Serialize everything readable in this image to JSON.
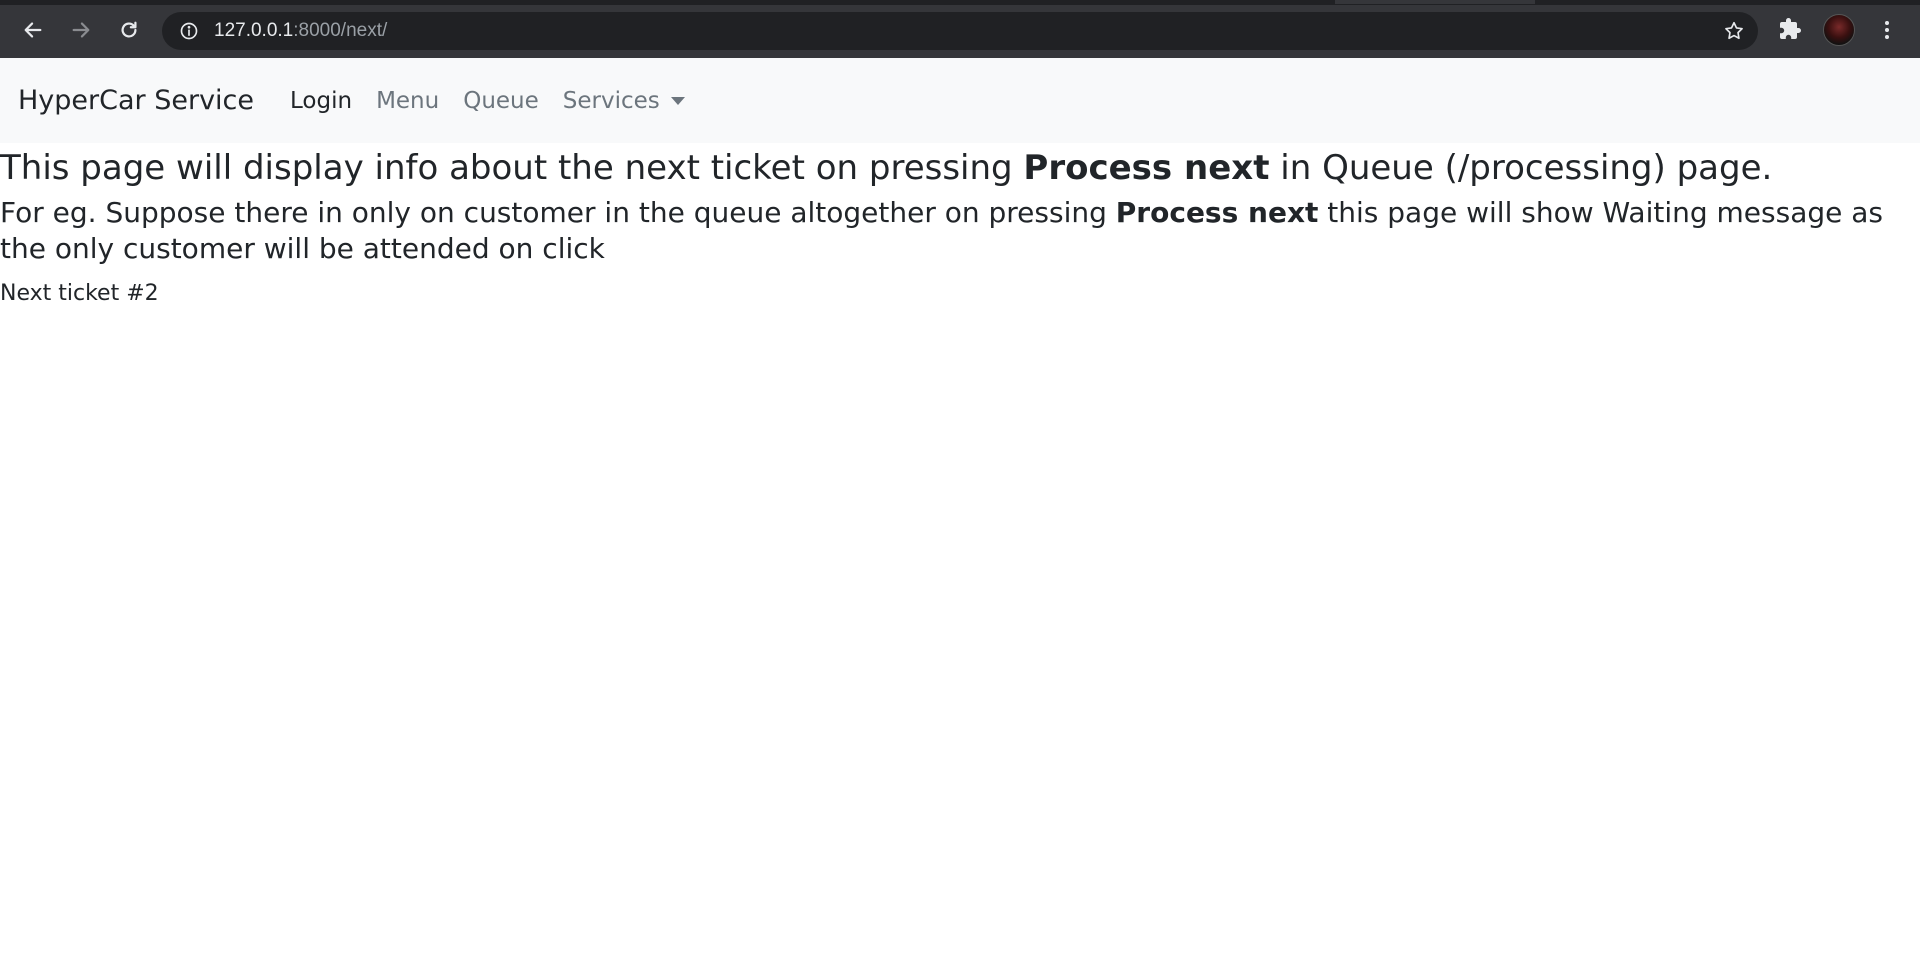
{
  "browser": {
    "url_host": "127.0.0.1",
    "url_rest": ":8000/next/",
    "icons": {
      "back": "arrow-left-icon",
      "forward": "arrow-right-icon",
      "reload": "reload-icon",
      "info": "info-icon",
      "bookmark": "star-icon",
      "extensions": "puzzle-icon",
      "menu": "kebab-icon"
    }
  },
  "navbar": {
    "brand": "HyperCar Service",
    "links": {
      "login": "Login",
      "menu": "Menu",
      "queue": "Queue",
      "services": "Services"
    }
  },
  "content": {
    "title_part1": "This page will display info about the next ticket on pressing ",
    "title_bold": "Process next",
    "title_part2": " in Queue (/processing) page.",
    "note_part1": "For eg. Suppose there in only on customer in the queue altogether on pressing ",
    "note_bold": "Process next",
    "note_part2": " this page will show Waiting message as the only customer will be attended on click",
    "ticket": "Next ticket #2"
  },
  "colors": {
    "chrome_bg": "#35363a",
    "omnibox_bg": "#202124",
    "navbar_bg": "#f8f9fa",
    "text": "#212529",
    "muted_link": "#6c757d"
  }
}
